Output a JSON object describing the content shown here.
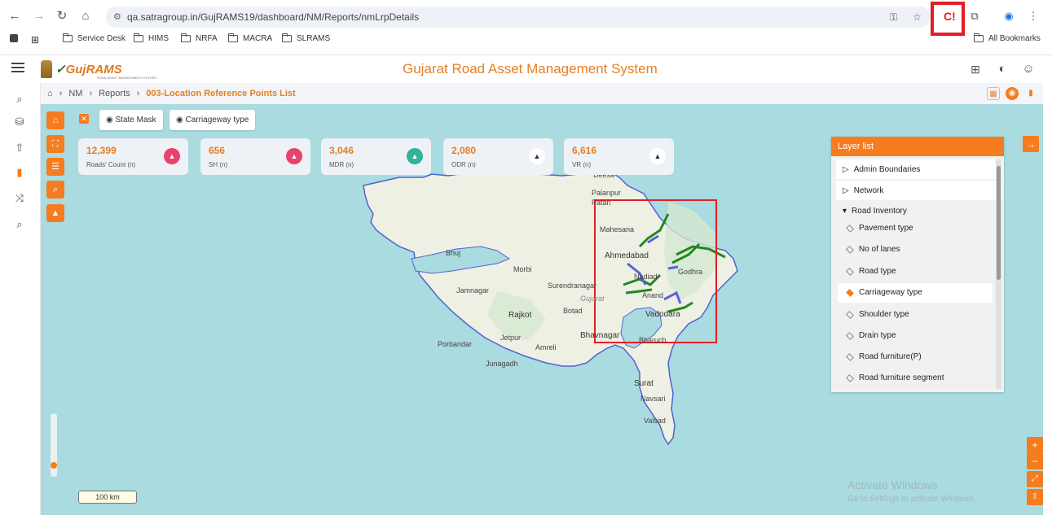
{
  "browser": {
    "url": "qa.satragroup.in/GujRAMS19/dashboard/NM/Reports/nmLrpDetails",
    "bookmarks": [
      "Service Desk",
      "HIMS",
      "NRFA",
      "MACRA",
      "SLRAMS"
    ],
    "all_bookmarks": "All Bookmarks"
  },
  "app": {
    "logo": "GujRAMS",
    "logo_sub": "ROAD ASSET MANAGEMENT SYSTEM",
    "title": "Gujarat Road Asset Management System"
  },
  "breadcrumb": {
    "items": [
      "NM",
      "Reports"
    ],
    "current": "003-Location Reference Points List"
  },
  "chips": {
    "state_mask": "State Mask",
    "carriageway": "Carriageway type"
  },
  "stats": [
    {
      "value": "12,399",
      "label": "Roads' Count (n)",
      "color": "#e8436c"
    },
    {
      "value": "656",
      "label": "SH (n)",
      "color": "#e8436c"
    },
    {
      "value": "3,046",
      "label": "MDR (n)",
      "color": "#2fb39a"
    },
    {
      "value": "2,080",
      "label": "ODR (n)",
      "color": "#ffffff"
    },
    {
      "value": "6,616",
      "label": "VR (n)",
      "color": "#ffffff"
    }
  ],
  "layer_list": {
    "title": "Layer list",
    "sections": [
      "Admin Boundaries",
      "Network",
      "Road Inventory"
    ],
    "items": [
      "Pavement type",
      "No of lanes",
      "Road type",
      "Carriageway type",
      "Shoulder type",
      "Drain type",
      "Road furniture(P)",
      "Road furniture segment"
    ],
    "selected": "Carriageway type"
  },
  "map": {
    "cities": [
      "Deesa",
      "Palanpur",
      "Patan",
      "Mahesana",
      "Ahmedabad",
      "Godhra",
      "Nadiad",
      "Anand",
      "Vadodara",
      "Bharuch",
      "Surat",
      "Navsari",
      "Valsad",
      "Bhuj",
      "Morbi",
      "Jamnagar",
      "Surendranagar",
      "Rajkot",
      "Botad",
      "Bhavnagar",
      "Jetpur",
      "Amreli",
      "Porbandar",
      "Junagadh"
    ],
    "state_label": "Gujarat",
    "scale": "100 km"
  },
  "watermark": {
    "line1": "Activate Windows",
    "line2": "Go to Settings to activate Windows."
  },
  "colors": {
    "accent": "#f57c1f",
    "title": "#e67e22",
    "green_road": "#1e8a1e",
    "blue_road": "#5a63d8",
    "highlight_box": "#e31e24"
  }
}
